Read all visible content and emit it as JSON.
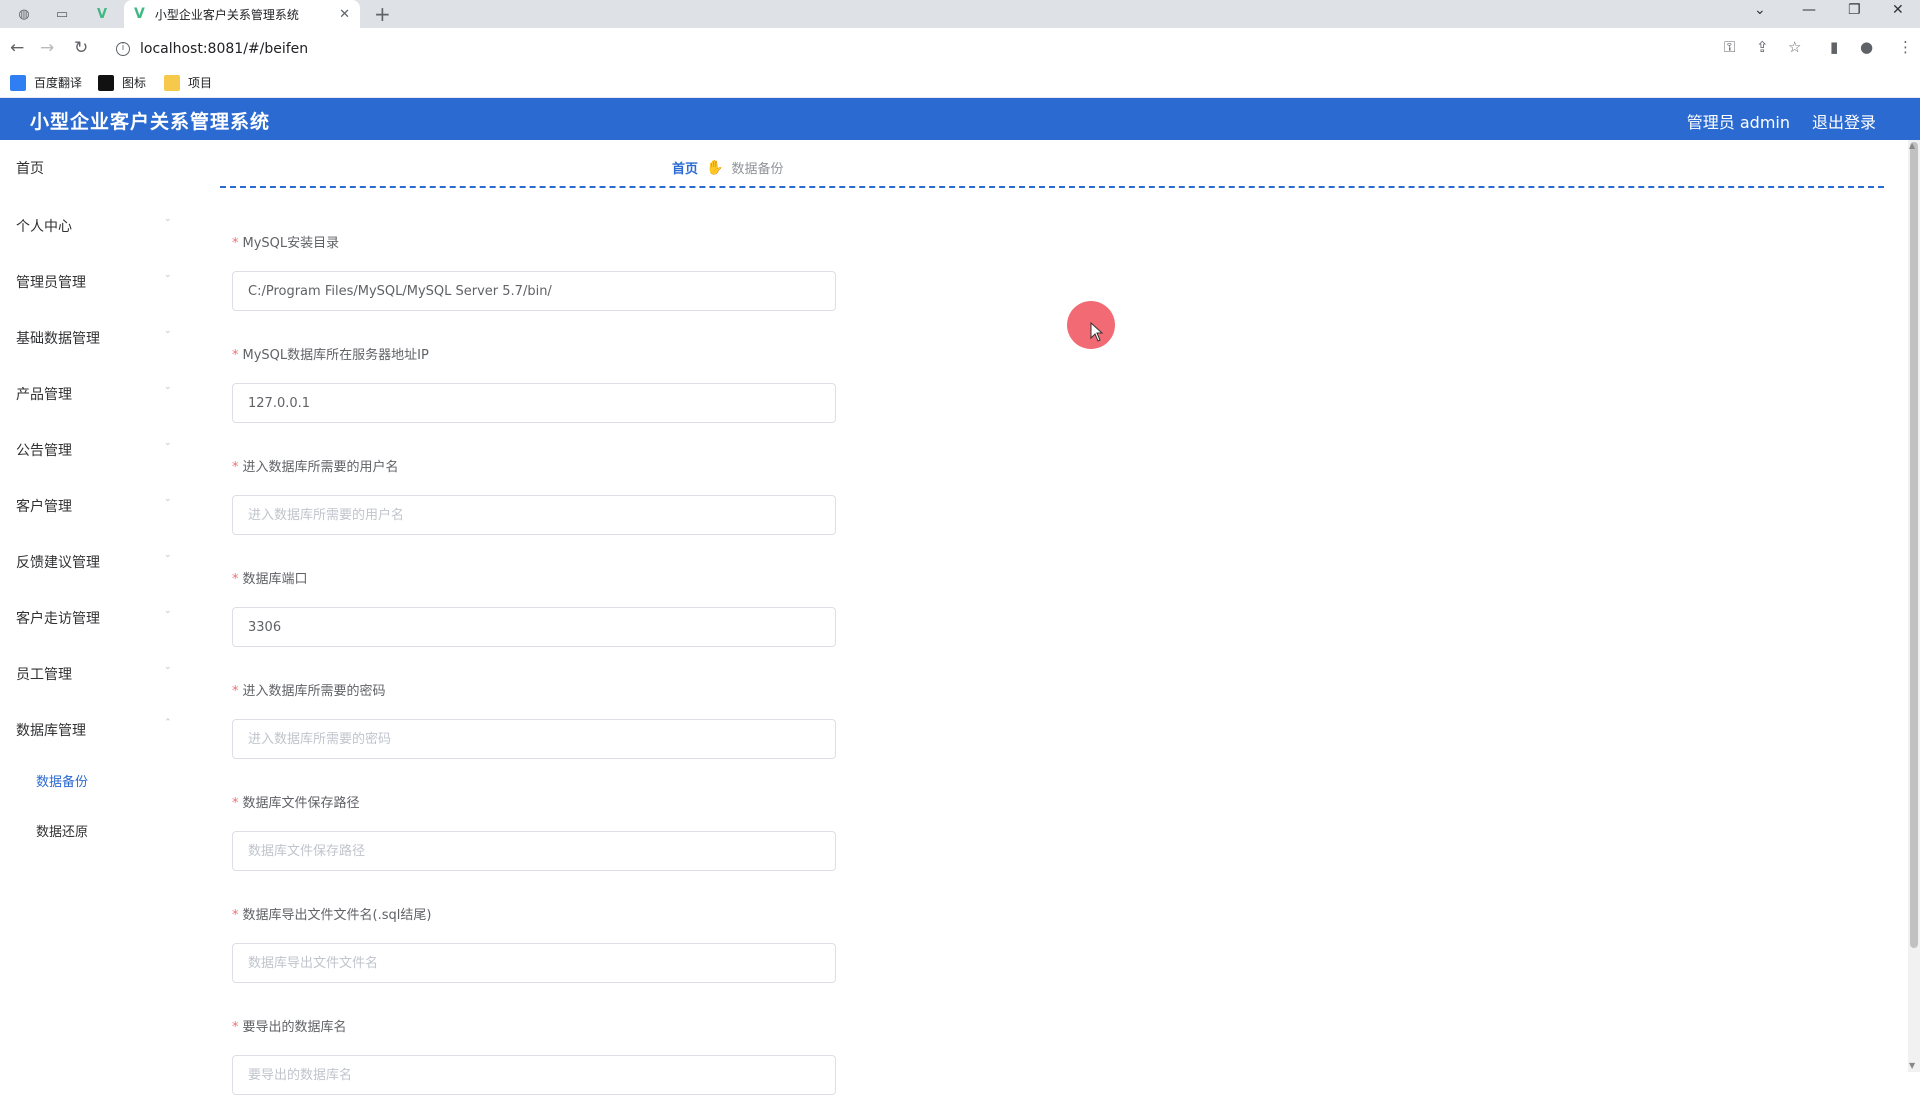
{
  "browser": {
    "tab_title": "小型企业客户关系管理系统",
    "tab_close": "✕",
    "new_tab": "+",
    "url": "localhost:8081/#/beifen",
    "bookmarks": [
      {
        "label": "百度翻译",
        "color": "#2f7ff3"
      },
      {
        "label": "图标",
        "color": "#111111"
      },
      {
        "label": "项目",
        "color": "#f6c94b"
      }
    ]
  },
  "header": {
    "title": "小型企业客户关系管理系统",
    "admin": "管理员 admin",
    "logout": "退出登录",
    "color": "#2b6ad0"
  },
  "sidebar": {
    "items": [
      {
        "label": "首页"
      },
      {
        "label": "个人中心"
      },
      {
        "label": "管理员管理"
      },
      {
        "label": "基础数据管理"
      },
      {
        "label": "产品管理"
      },
      {
        "label": "公告管理"
      },
      {
        "label": "客户管理"
      },
      {
        "label": "反馈建议管理"
      },
      {
        "label": "客户走访管理"
      },
      {
        "label": "员工管理"
      },
      {
        "label": "数据库管理"
      }
    ],
    "sub_items": [
      {
        "label": "数据备份",
        "active": true
      },
      {
        "label": "数据还原",
        "active": false
      }
    ]
  },
  "breadcrumb": {
    "home": "首页",
    "current": "数据备份"
  },
  "form": {
    "fields": [
      {
        "label": "MySQL安装目录",
        "value": "C:/Program Files/MySQL/MySQL Server 5.7/bin/",
        "placeholder": ""
      },
      {
        "label": "MySQL数据库所在服务器地址IP",
        "value": "127.0.0.1",
        "placeholder": ""
      },
      {
        "label": "进入数据库所需要的用户名",
        "value": "",
        "placeholder": "进入数据库所需要的用户名"
      },
      {
        "label": "数据库端口",
        "value": "3306",
        "placeholder": ""
      },
      {
        "label": "进入数据库所需要的密码",
        "value": "",
        "placeholder": "进入数据库所需要的密码"
      },
      {
        "label": "数据库文件保存路径",
        "value": "",
        "placeholder": "数据库文件保存路径"
      },
      {
        "label": "数据库导出文件文件名(.sql结尾)",
        "value": "",
        "placeholder": "数据库导出文件文件名"
      },
      {
        "label": "要导出的数据库名",
        "value": "",
        "placeholder": "要导出的数据库名"
      }
    ],
    "required_mark": "*"
  }
}
